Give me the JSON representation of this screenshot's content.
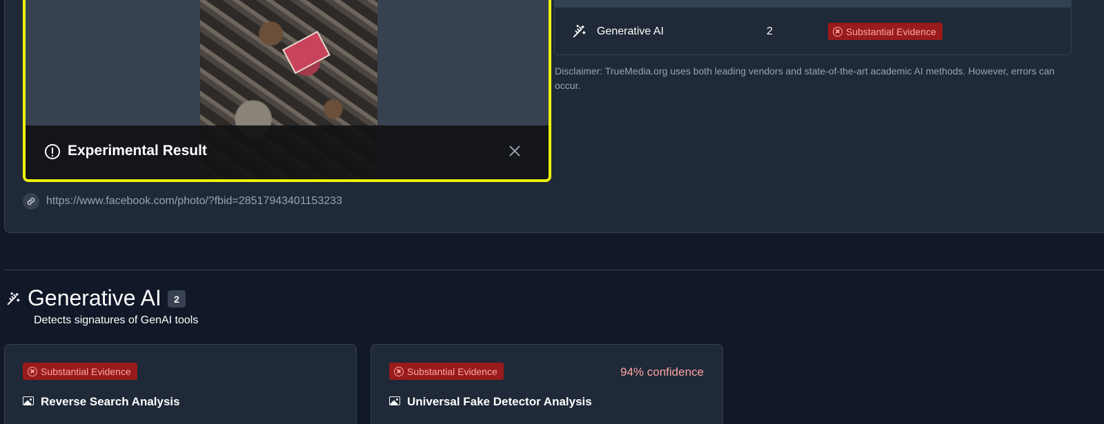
{
  "media": {
    "banner_title": "Experimental Result",
    "source_url": "https://www.facebook.com/photo/?fbid=28517943401153233"
  },
  "summary": {
    "rows": [
      {
        "name": "Generative AI",
        "count": "2",
        "verdict": "Substantial Evidence"
      }
    ],
    "disclaimer": "Disclaimer: TrueMedia.org uses both leading vendors and state-of-the-art academic AI methods. However, errors can occur."
  },
  "section": {
    "title": "Generative AI",
    "count": "2",
    "description": "Detects signatures of GenAI tools"
  },
  "cards": [
    {
      "verdict": "Substantial Evidence",
      "title": "Reverse Search Analysis",
      "confidence": ""
    },
    {
      "verdict": "Substantial Evidence",
      "title": "Universal Fake Detector Analysis",
      "confidence": "94% confidence"
    }
  ],
  "colors": {
    "highlight_border": "#eef20b",
    "badge_bg": "#991b1b",
    "badge_text": "#fca5a5",
    "page_bg": "#111827",
    "panel_bg": "#1f2937"
  },
  "icons": {
    "banner": "alert-circle-icon",
    "close": "close-icon",
    "link": "link-icon",
    "category": "magic-wand-icon",
    "badge": "x-circle-icon",
    "card": "image-icon"
  }
}
